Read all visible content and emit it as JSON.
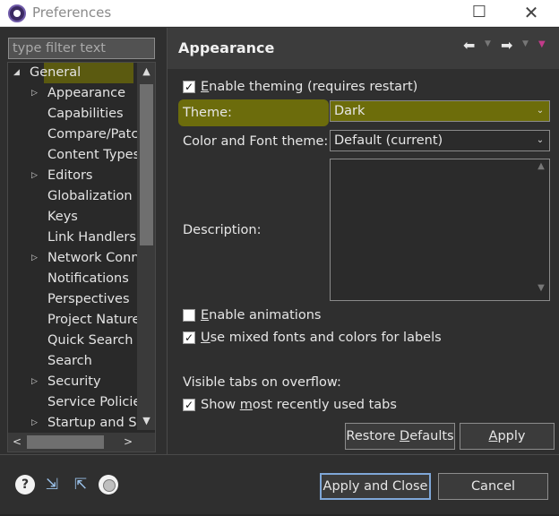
{
  "window": {
    "title": "Preferences",
    "maximize_glyph": "☐",
    "close_glyph": "✕"
  },
  "filter": {
    "placeholder": "type filter text"
  },
  "tree": {
    "items": [
      {
        "label": "General",
        "arrow": "◢"
      },
      {
        "label": "Appearance",
        "arrow": "▷",
        "selected": true
      },
      {
        "label": "Capabilities",
        "arrow": ""
      },
      {
        "label": "Compare/Patch",
        "arrow": ""
      },
      {
        "label": "Content Types",
        "arrow": ""
      },
      {
        "label": "Editors",
        "arrow": "▷"
      },
      {
        "label": "Globalization",
        "arrow": ""
      },
      {
        "label": "Keys",
        "arrow": ""
      },
      {
        "label": "Link Handlers",
        "arrow": ""
      },
      {
        "label": "Network Connections",
        "arrow": "▷"
      },
      {
        "label": "Notifications",
        "arrow": ""
      },
      {
        "label": "Perspectives",
        "arrow": ""
      },
      {
        "label": "Project Natures",
        "arrow": ""
      },
      {
        "label": "Quick Search",
        "arrow": ""
      },
      {
        "label": "Search",
        "arrow": ""
      },
      {
        "label": "Security",
        "arrow": "▷"
      },
      {
        "label": "Service Policies",
        "arrow": ""
      },
      {
        "label": "Startup and Shutdown",
        "arrow": "▷"
      }
    ],
    "scroll_up": "▲",
    "scroll_down": "▼",
    "scroll_left": "<",
    "scroll_right": ">"
  },
  "page": {
    "title": "Appearance",
    "nav": {
      "back": "⬅",
      "forward": "➡",
      "caret": "▼",
      "menu": "▼"
    },
    "enable_theming": {
      "u": "E",
      "rest": "nable theming (requires restart)",
      "checked": true
    },
    "theme_label": "Theme:",
    "theme_value": "Dark",
    "color_font_label": "Color and Font theme:",
    "color_font_value": "Default (current)",
    "description_label": "Description:",
    "enable_animations": {
      "u": "E",
      "rest": "nable animations",
      "checked": false
    },
    "mixed_fonts": {
      "u": "U",
      "rest": "se mixed fonts and colors for labels",
      "checked": true
    },
    "visible_tabs_label": "Visible tabs on overflow:",
    "show_mru": {
      "pre": "Show ",
      "u": "m",
      "rest": "ost recently used tabs",
      "checked": true
    },
    "restore_defaults": {
      "pre": "Restore ",
      "u": "D",
      "rest": "efaults"
    },
    "apply": {
      "u": "A",
      "rest": "pply"
    },
    "combo_arrow": "⌄",
    "check_glyph": "✓"
  },
  "footer": {
    "help_glyph": "?",
    "import_glyph": "⇲",
    "export_glyph": "⇱",
    "apply_close": "Apply and Close",
    "cancel": "Cancel"
  },
  "colors": {
    "background": "#2f2f2f",
    "highlight": "#6d6d0a",
    "primary_border": "#7fa7d8"
  }
}
